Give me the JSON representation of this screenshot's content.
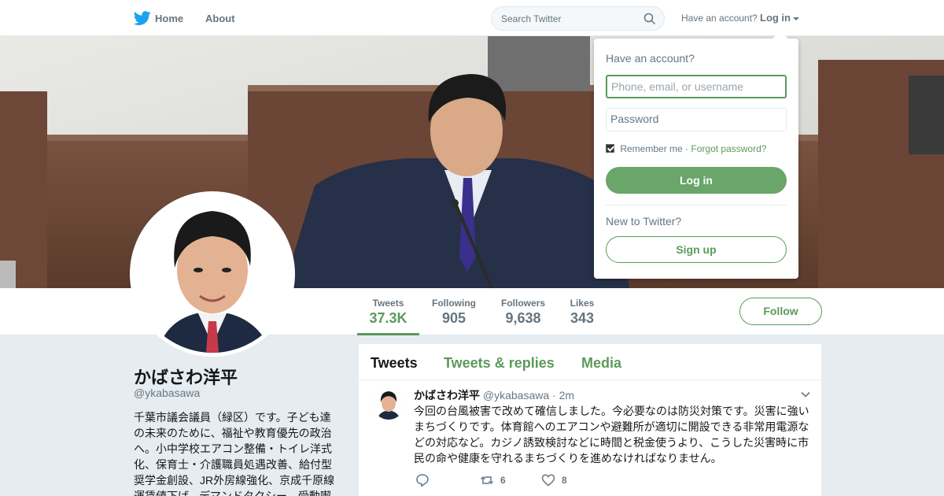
{
  "nav": {
    "home_label": "Home",
    "about_label": "About",
    "search_placeholder": "Search Twitter",
    "have_account": "Have an account?",
    "login_label": "Log in"
  },
  "colors": {
    "accent": "#5b9a5a",
    "button_fill": "#6aa56a",
    "nav_text": "#66757f",
    "page_bg": "#e6ecf0"
  },
  "profile": {
    "name": "かばさわ洋平",
    "handle": "@ykabasawa",
    "bio": "千葉市議会議員（緑区）です。子ども達の未来のために、福祉や教育優先の政治へ。小中学校エアコン整備・トイレ洋式化、保育士・介護職員処遇改善、給付型奨学金創設、JR外房線強化、京成千原線運賃値下げ、デマンドタクシー、受動喫"
  },
  "stats": [
    {
      "label": "Tweets",
      "value": "37.3K",
      "active": true
    },
    {
      "label": "Following",
      "value": "905"
    },
    {
      "label": "Followers",
      "value": "9,638"
    },
    {
      "label": "Likes",
      "value": "343"
    }
  ],
  "follow_label": "Follow",
  "tabs": {
    "tweets": "Tweets",
    "replies": "Tweets & replies",
    "media": "Media"
  },
  "tweet": {
    "name": "かばさわ洋平",
    "handle": "@ykabasawa",
    "dot": "·",
    "time": "2m",
    "text": "今回の台風被害で改めて確信しました。今必要なのは防災対策です。災害に強いまちづくりです。体育館へのエアコンや避難所が適切に開設できる非常用電源などの対応など。カジノ誘致検討などに時間と税金使うより、こうした災害時に市民の命や健康を守れるまちづくりを進めなければなりません。",
    "reply_count": "",
    "retweet_count": "6",
    "like_count": "8"
  },
  "login_dropdown": {
    "title": "Have an account?",
    "username_placeholder": "Phone, email, or username",
    "password_placeholder": "Password",
    "remember_label": "Remember me",
    "separator": "·",
    "forgot_label": "Forgot password?",
    "login_button": "Log in",
    "new_label": "New to Twitter?",
    "signup_button": "Sign up"
  }
}
